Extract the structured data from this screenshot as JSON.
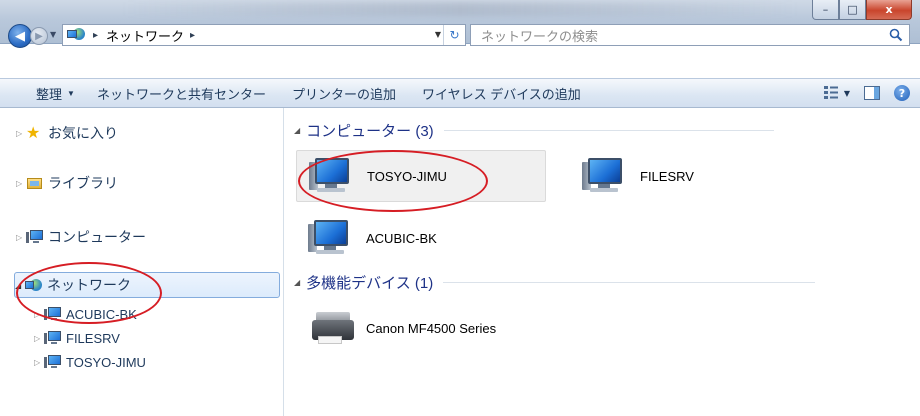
{
  "titlebar": {
    "controls": {
      "minimize": "–",
      "maximize": "□",
      "close": "x"
    }
  },
  "nav": {
    "back_glyph": "◀",
    "forward_glyph": "▶",
    "dropdown_glyph": "▼",
    "address_path": [
      "ネットワーク"
    ],
    "address_sep": "▸",
    "refresh_glyph": "↻",
    "search_placeholder": "ネットワークの検索"
  },
  "cmdbar": {
    "organize": "整理",
    "network_center": "ネットワークと共有センター",
    "add_printer": "プリンターの追加",
    "add_wireless": "ワイヤレス デバイスの追加",
    "help_glyph": "?"
  },
  "navpane": {
    "favorites": "お気に入り",
    "libraries": "ライブラリ",
    "computer": "コンピューター",
    "network": "ネットワーク",
    "network_children": [
      "ACUBIC-BK",
      "FILESRV",
      "TOSYO-JIMU"
    ]
  },
  "content": {
    "computers_header": "コンピューター (3)",
    "computers": [
      "TOSYO-JIMU",
      "FILESRV",
      "ACUBIC-BK"
    ],
    "devices_header": "多機能デバイス (1)",
    "devices": [
      "Canon MF4500 Series"
    ]
  },
  "colors": {
    "accent_blue": "#1e3287",
    "annotation_red": "#d61d24",
    "selection_border": "#84acdd"
  }
}
